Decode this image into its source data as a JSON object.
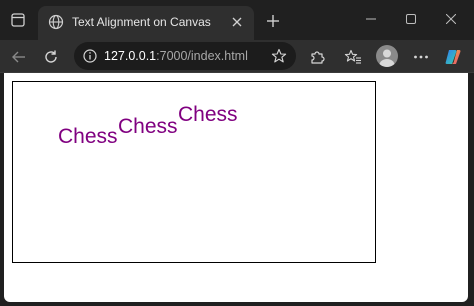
{
  "browser": {
    "tab_title": "Text Alignment on Canvas",
    "url_host": "127.0.0.1",
    "url_rest": ":7000/index.html",
    "icons": {
      "tab_actions": "tab-actions-icon",
      "favicon": "globe-icon",
      "close": "close-icon",
      "new_tab": "plus-icon",
      "minimize": "minimize-icon",
      "maximize": "maximize-icon",
      "window_close": "close-icon",
      "back": "back-arrow-icon",
      "refresh": "refresh-icon",
      "site_info": "info-icon",
      "favorite": "star-icon",
      "extensions": "puzzle-icon",
      "favorites": "favorites-icon",
      "profile": "avatar",
      "more": "more-icon",
      "copilot": "copilot-icon"
    }
  },
  "page": {
    "canvas_texts": [
      "Chess",
      "Chess",
      "Chess"
    ],
    "text_color": "#800080"
  }
}
